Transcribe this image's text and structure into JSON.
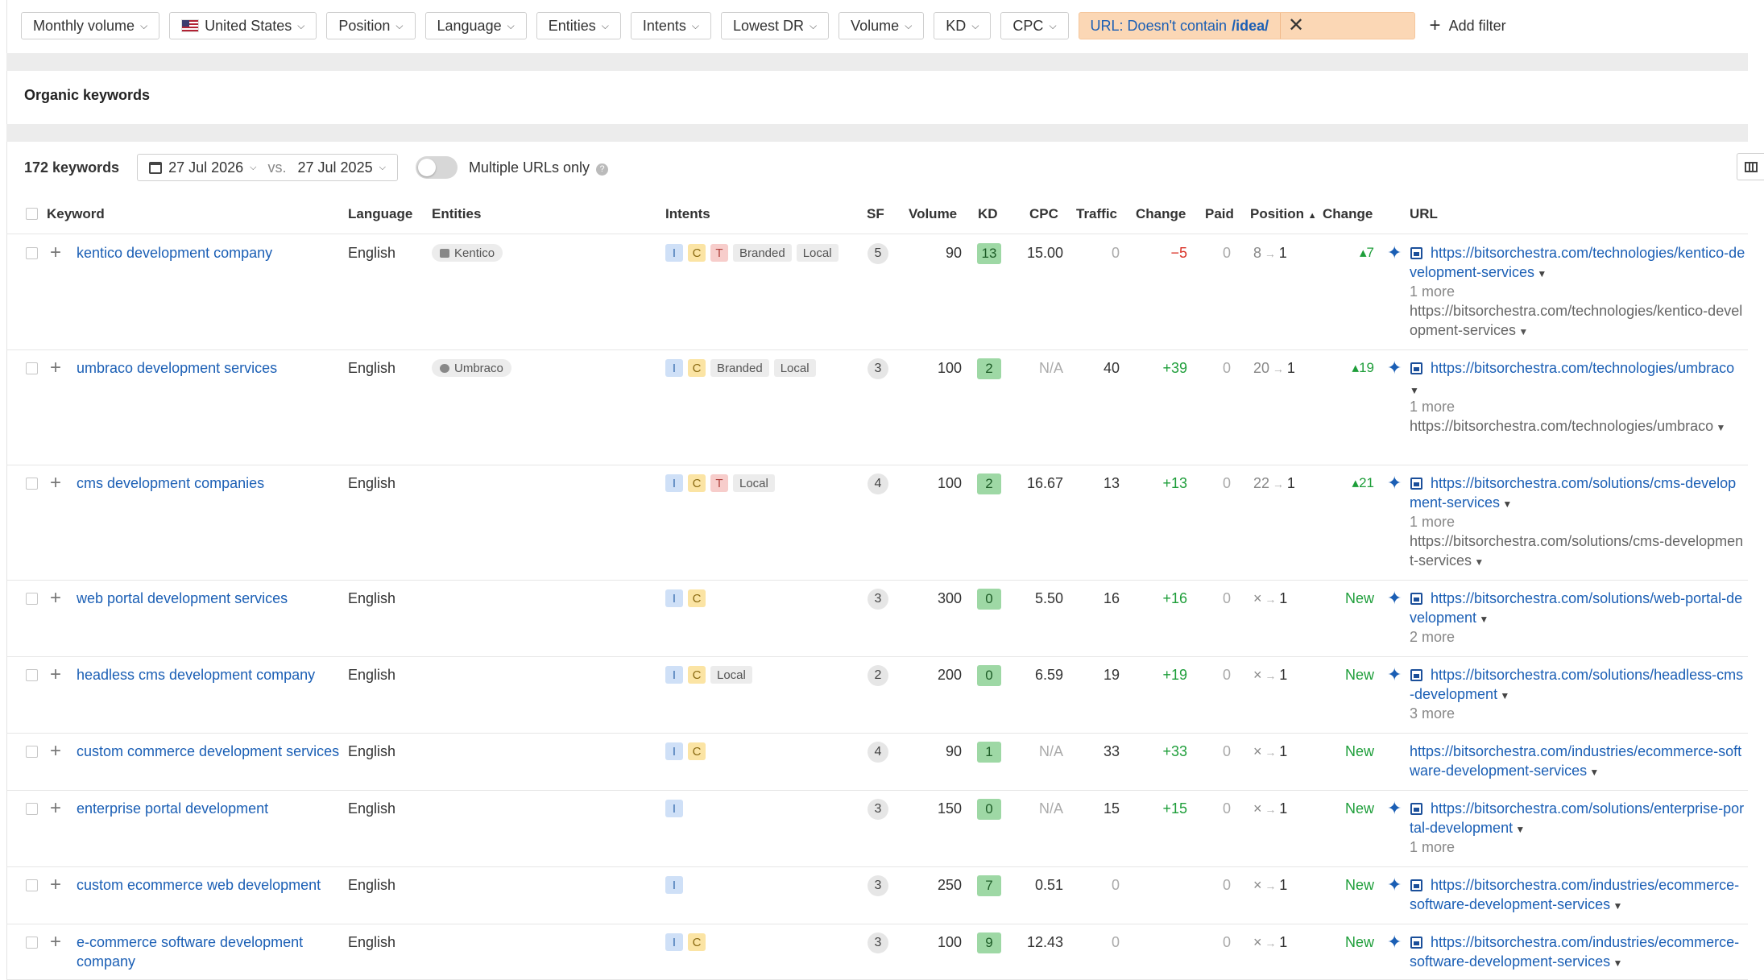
{
  "filters": [
    {
      "label": "Monthly volume"
    },
    {
      "label": "United States",
      "flag": "us-flag"
    },
    {
      "label": "Position"
    },
    {
      "label": "Language"
    },
    {
      "label": "Entities"
    },
    {
      "label": "Intents"
    },
    {
      "label": "Lowest DR"
    },
    {
      "label": "Volume"
    },
    {
      "label": "KD"
    },
    {
      "label": "CPC"
    }
  ],
  "url_filter": {
    "prefix": "URL: Doesn't contain",
    "value": "/idea/"
  },
  "add_filter": "Add filter",
  "section_title": "Organic keywords",
  "toolbar": {
    "keyword_count": "172 keywords",
    "date_current": "27 Jul 2026",
    "vs": "vs.",
    "date_compare": "27 Jul 2025",
    "multiple_urls": "Multiple URLs only"
  },
  "columns": {
    "keyword": "Keyword",
    "language": "Language",
    "entities": "Entities",
    "intents": "Intents",
    "sf": "SF",
    "volume": "Volume",
    "kd": "KD",
    "cpc": "CPC",
    "traffic": "Traffic",
    "change": "Change",
    "paid": "Paid",
    "position": "Position",
    "pos_change": "Change",
    "url": "URL"
  },
  "rows": [
    {
      "keyword": "kentico development company",
      "language": "English",
      "entity": "Kentico",
      "intents": [
        "I",
        "C",
        "T"
      ],
      "intent_words": [
        "Branded",
        "Local"
      ],
      "sf": "5",
      "volume": "90",
      "kd": "13",
      "cpc": "15.00",
      "traffic": "0",
      "change": "−5",
      "paid": "0",
      "pos_from": "8",
      "pos_to": "1",
      "pos_change": "▴7",
      "url": "https://bitsorchestra.com/technologies/kentico-development-services",
      "more": "1 more",
      "url2": "https://bitsorchestra.com/technologies/kentico-development-services"
    },
    {
      "keyword": "umbraco development services",
      "language": "English",
      "entity": "Umbraco",
      "intents": [
        "I",
        "C"
      ],
      "intent_words": [
        "Branded",
        "Local"
      ],
      "sf": "3",
      "volume": "100",
      "kd": "2",
      "cpc": "N/A",
      "traffic": "40",
      "change": "+39",
      "paid": "0",
      "pos_from": "20",
      "pos_to": "1",
      "pos_change": "▴19",
      "url": "https://bitsorchestra.com/technologies/umbraco",
      "more": "1 more",
      "url2": "https://bitsorchestra.com/technologies/umbraco"
    },
    {
      "keyword": "cms development companies",
      "language": "English",
      "entity": "",
      "intents": [
        "I",
        "C",
        "T"
      ],
      "intent_words": [
        "Local"
      ],
      "sf": "4",
      "volume": "100",
      "kd": "2",
      "cpc": "16.67",
      "traffic": "13",
      "change": "+13",
      "paid": "0",
      "pos_from": "22",
      "pos_to": "1",
      "pos_change": "▴21",
      "url": "https://bitsorchestra.com/solutions/cms-development-services",
      "more": "1 more",
      "url2": "https://bitsorchestra.com/solutions/cms-development-services"
    },
    {
      "keyword": "web portal development services",
      "language": "English",
      "entity": "",
      "intents": [
        "I",
        "C"
      ],
      "intent_words": [],
      "sf": "3",
      "volume": "300",
      "kd": "0",
      "cpc": "5.50",
      "traffic": "16",
      "change": "+16",
      "paid": "0",
      "pos_from": "×",
      "pos_to": "1",
      "pos_change": "New",
      "url": "https://bitsorchestra.com/solutions/web-portal-development",
      "more": "2 more",
      "url2": ""
    },
    {
      "keyword": "headless cms development company",
      "language": "English",
      "entity": "",
      "intents": [
        "I",
        "C"
      ],
      "intent_words": [
        "Local"
      ],
      "sf": "2",
      "volume": "200",
      "kd": "0",
      "cpc": "6.59",
      "traffic": "19",
      "change": "+19",
      "paid": "0",
      "pos_from": "×",
      "pos_to": "1",
      "pos_change": "New",
      "url": "https://bitsorchestra.com/solutions/headless-cms-development",
      "more": "3 more",
      "url2": ""
    },
    {
      "keyword": "custom commerce development services",
      "language": "English",
      "entity": "",
      "intents": [
        "I",
        "C"
      ],
      "intent_words": [],
      "sf": "4",
      "volume": "90",
      "kd": "1",
      "cpc": "N/A",
      "traffic": "33",
      "change": "+33",
      "paid": "0",
      "pos_from": "×",
      "pos_to": "1",
      "pos_change": "New",
      "url": "https://bitsorchestra.com/industries/ecommerce-software-development-services",
      "more": "",
      "url2": ""
    },
    {
      "keyword": "enterprise portal development",
      "language": "English",
      "entity": "",
      "intents": [
        "I"
      ],
      "intent_words": [],
      "sf": "3",
      "volume": "150",
      "kd": "0",
      "cpc": "N/A",
      "traffic": "15",
      "change": "+15",
      "paid": "0",
      "pos_from": "×",
      "pos_to": "1",
      "pos_change": "New",
      "url": "https://bitsorchestra.com/solutions/enterprise-portal-development",
      "more": "1 more",
      "url2": ""
    },
    {
      "keyword": "custom ecommerce web development",
      "language": "English",
      "entity": "",
      "intents": [
        "I"
      ],
      "intent_words": [],
      "sf": "3",
      "volume": "250",
      "kd": "7",
      "cpc": "0.51",
      "traffic": "0",
      "change": "",
      "paid": "0",
      "pos_from": "×",
      "pos_to": "1",
      "pos_change": "New",
      "url": "https://bitsorchestra.com/industries/ecommerce-software-development-services",
      "more": "",
      "url2": ""
    },
    {
      "keyword": "e-commerce software development company",
      "language": "English",
      "entity": "",
      "intents": [
        "I",
        "C"
      ],
      "intent_words": [],
      "sf": "3",
      "volume": "100",
      "kd": "9",
      "cpc": "12.43",
      "traffic": "0",
      "change": "",
      "paid": "0",
      "pos_from": "×",
      "pos_to": "1",
      "pos_change": "New",
      "url": "https://bitsorchestra.com/industries/ecommerce-software-development-services",
      "more": "",
      "url2": ""
    }
  ]
}
